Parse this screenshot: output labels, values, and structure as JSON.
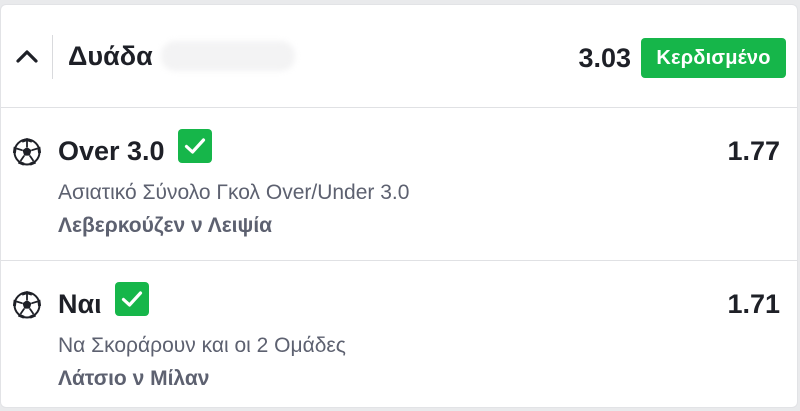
{
  "header": {
    "title": "Δυάδα",
    "odds": "3.03",
    "status": "Κερδισμένο",
    "status_color": "#16b64a"
  },
  "selections": [
    {
      "name": "Over 3.0",
      "odds": "1.77",
      "market": "Ασιατικό Σύνολο Γκολ Over/Under 3.0",
      "event": "Λεβερκούζεν ν Λειψία",
      "sport_icon": "soccer-ball-icon",
      "result_icon": "check-icon"
    },
    {
      "name": "Ναι",
      "odds": "1.71",
      "market": "Να Σκοράρουν και οι 2 Ομάδες",
      "event": "Λάτσιο ν Μίλαν",
      "sport_icon": "soccer-ball-icon",
      "result_icon": "check-icon"
    }
  ]
}
